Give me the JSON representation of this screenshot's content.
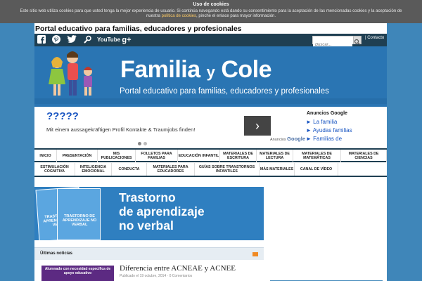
{
  "cookie": {
    "title": "Uso de cookies",
    "message": "Este sitio web utiliza cookies para que usted tenga la mejor experiencia de usuario. Si continúa navegando está dando su consentimiento para la aceptación de las mencionadas cookies y la aceptación de nuestra",
    "link": "política de cookies",
    "suffix": ", pinche el enlace para mayor información."
  },
  "site": {
    "title": "Portal educativo para familias, educadores y profesionales"
  },
  "social": {
    "icons": [
      "facebook-icon",
      "pinterest-icon",
      "twitter-icon",
      "search-people-icon",
      "youtube-icon",
      "google-plus-icon"
    ],
    "youtube": "YouTube",
    "gplus": "g+",
    "search_placeholder": "Buscar...",
    "contact": "| Contacto"
  },
  "banner": {
    "brand_a": "Familia",
    "brand_y": "y",
    "brand_b": "Cole",
    "tagline": "Portal educativo para familias, educadores y profesionales"
  },
  "ad": {
    "headline": "????",
    "body": "Mit einem aussagekräftigen Profil Kontakte & Traumjobs finden!",
    "by": "Anuncios",
    "google": "Google",
    "links_title": "Anuncios Google",
    "links": [
      "► La familia",
      "► Ayudas familias",
      "► Familias de"
    ]
  },
  "nav": {
    "row1": [
      "INICIO",
      "PRESENTACIÓN",
      "MIS PUBLICACIONES",
      "FOLLETOS PARA FAMILIAS",
      "EDUCACIÓN INFANTIL",
      "MATERIALES DE ESCRITURA",
      "MATERIALES DE LECTURA",
      "MATERIALES DE MATEMÁTICAS",
      "MATERIALES DE CIENCIAS"
    ],
    "row2": [
      "ESTIMULACIÓN COGNITIVA",
      "INTELIGENCIA EMOCIONAL",
      "CONDUCTA",
      "MATERIALES PARA EDUCADORES",
      "GUÍAS SOBRE TRANSTORNOS INFANTILES",
      "MÁS MATERIALES",
      "CANAL DE VÍDEO"
    ]
  },
  "featured": {
    "book_title": "TRASTORNO DE APRENDIZAJE NO VERBAL",
    "line1": "Trastorno",
    "line2": "de aprendizaje",
    "line3": "no verbal"
  },
  "news": {
    "header": "Últimas noticias",
    "thumb_text": "Alumnado con necesidad específica de apoyo educativo",
    "post_title": "Diferencia entre ACNEAE y ACNEE",
    "post_meta": "Publicado el 19 octubre, 2014 · 0 Comentarios"
  },
  "colors": {
    "page_bg": "#3f86b9",
    "banner": "#2a75b3",
    "social_bar": "#1f3f52",
    "link": "#1a56c2"
  }
}
